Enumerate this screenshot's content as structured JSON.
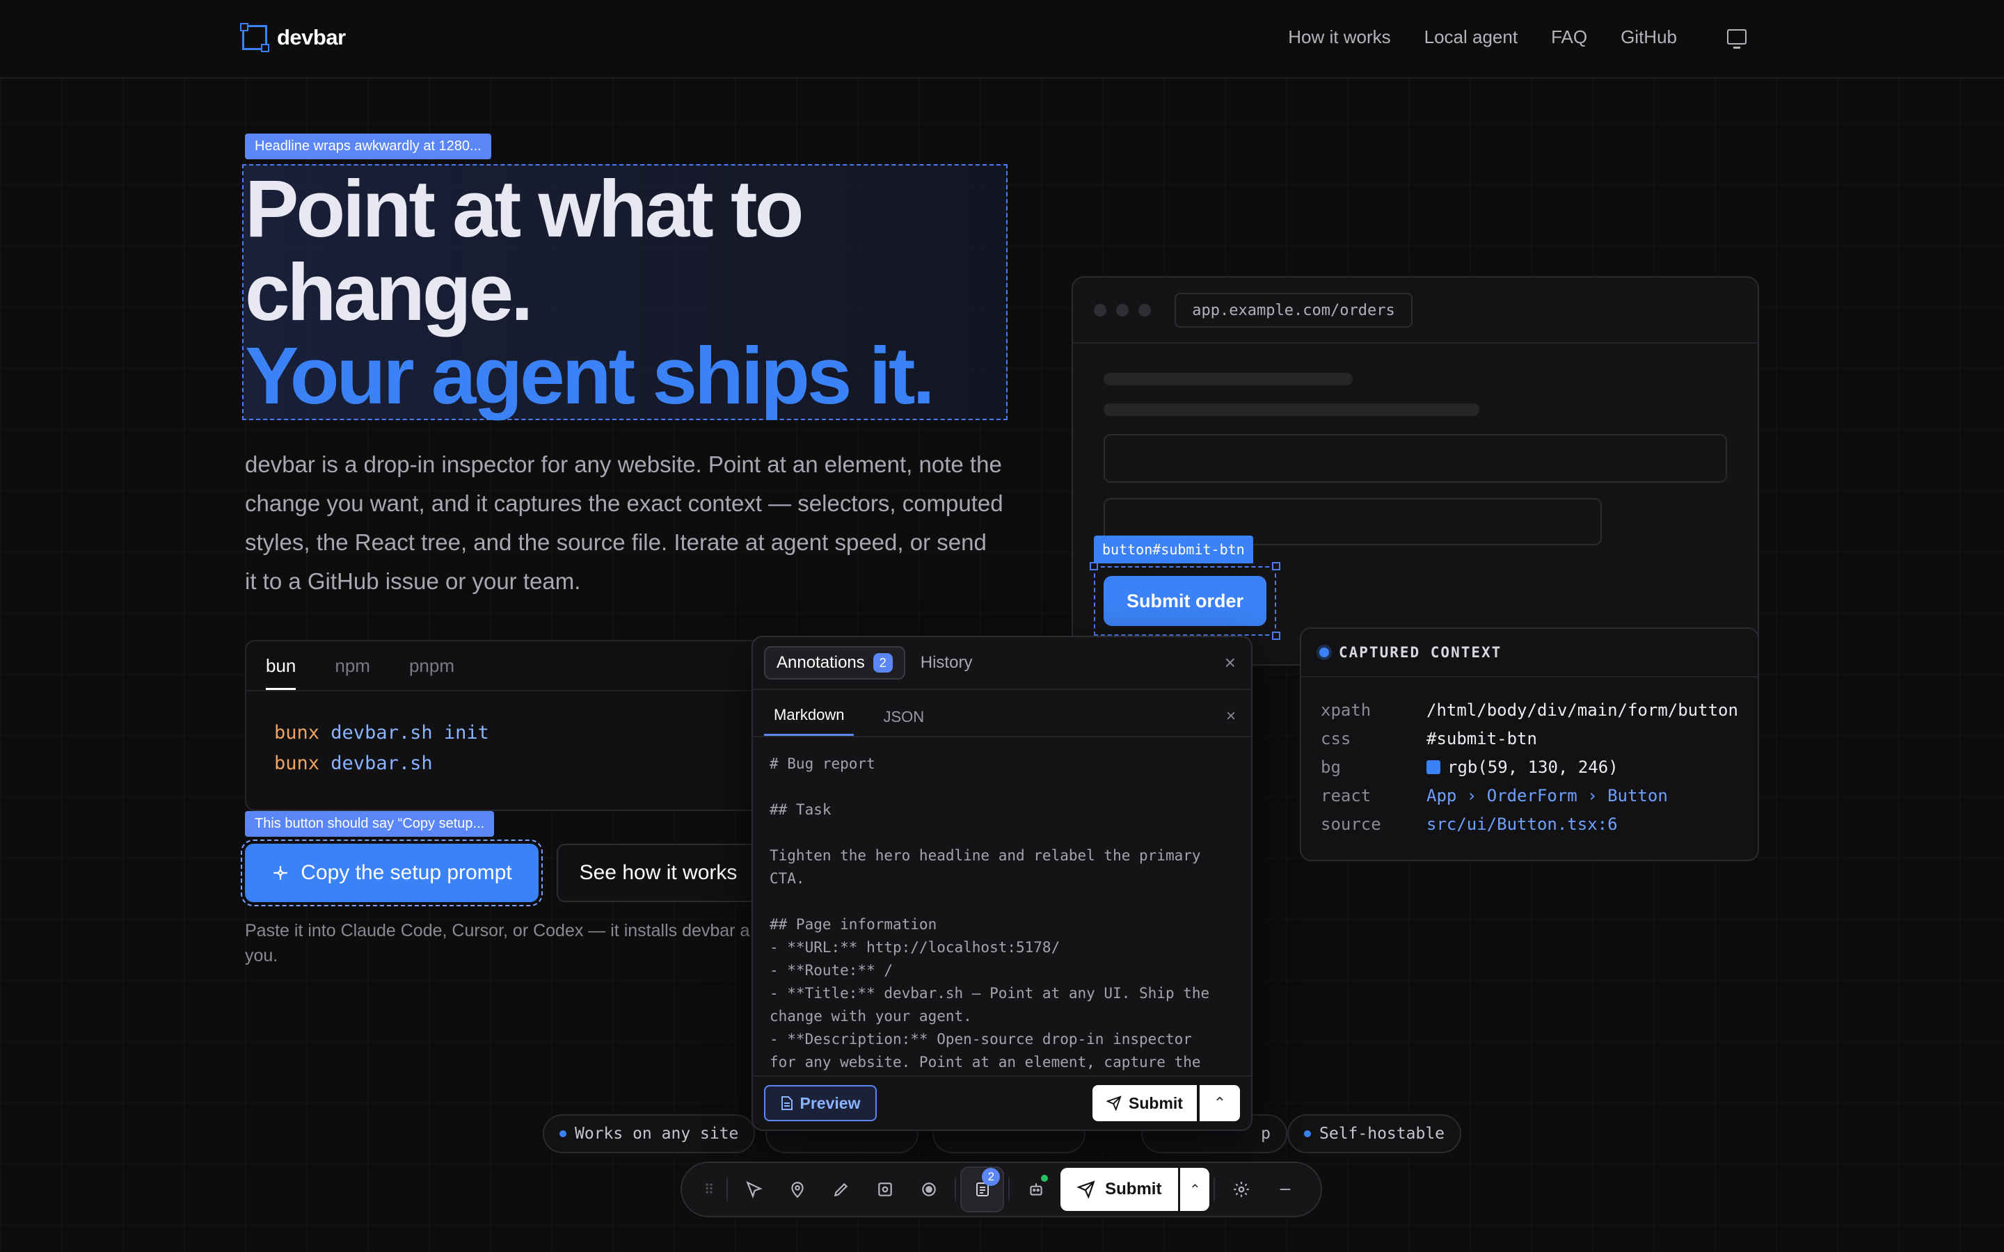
{
  "nav": {
    "brand": "devbar",
    "links": [
      "How it works",
      "Local agent",
      "FAQ",
      "GitHub"
    ],
    "theme_icon": "monitor-icon"
  },
  "hero": {
    "headline_tag": "Headline wraps awkwardly at 1280...",
    "headline_line1": "Point at what to",
    "headline_line2": "change.",
    "headline_line3": "Your agent ships it.",
    "lede": "devbar is a drop-in inspector for any website. Point at an element, note the change you want, and it captures the exact context — selectors, computed styles, the React tree, and the source file. Iterate at agent speed, or send it to a GitHub issue or your team.",
    "install_tabs": [
      "bun",
      "npm",
      "pnpm"
    ],
    "install_lines": [
      {
        "kw": "bunx",
        "cmd": "devbar.sh init"
      },
      {
        "kw": "bunx",
        "cmd": "devbar.sh"
      }
    ],
    "button_tag": "This button should say “Copy setup...",
    "primary_cta": "Copy the setup prompt",
    "secondary_cta": "See how it works",
    "paste_note": "Paste it into Claude Code, Cursor, or Codex — it installs devbar a",
    "paste_note_2": "you."
  },
  "browser": {
    "url": "app.example.com/orders",
    "selector_tag": "button#submit-btn",
    "submit_label": "Submit order"
  },
  "context": {
    "title": "CAPTURED CONTEXT",
    "rows": [
      {
        "k": "xpath",
        "v": "/html/body/div/main/form/button"
      },
      {
        "k": "css",
        "v": "#submit-btn"
      },
      {
        "k": "bg",
        "v": "rgb(59, 130, 246)"
      },
      {
        "k": "react",
        "v": "App › OrderForm › Button"
      },
      {
        "k": "source",
        "v": "src/ui/Button.tsx:6"
      }
    ],
    "swatch_color": "#3b82f6"
  },
  "panel": {
    "tab_annotations": "Annotations",
    "annotations_count": "2",
    "tab_history": "History",
    "sub_markdown": "Markdown",
    "sub_json": "JSON",
    "body": "# Bug report\n\n## Task\n\nTighten the hero headline and relabel the primary\nCTA.\n\n## Page information\n- **URL:** http://localhost:5178/\n- **Route:** /\n- **Title:** devbar.sh — Point at any UI. Ship the\nchange with your agent.\n- **Description:** Open-source drop-in inspector\nfor any website. Point at an element, capture the",
    "preview_label": "Preview",
    "submit_label": "Submit"
  },
  "chips": [
    "Works on any site",
    "Self-hostable",
    "p"
  ],
  "toolbar": {
    "badge": "2",
    "submit_label": "Submit"
  },
  "colors": {
    "accent": "#3b82f6",
    "background": "#0d0d0e"
  }
}
